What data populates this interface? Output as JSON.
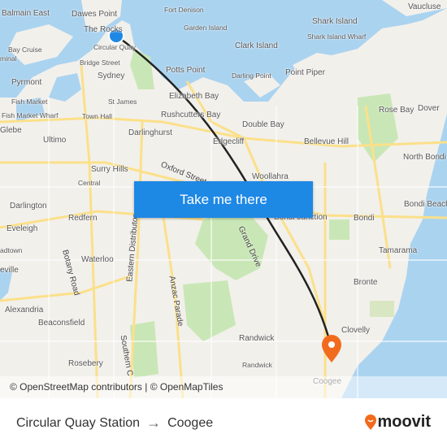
{
  "map": {
    "labels": [
      "Balmain East",
      "Dawes Point",
      "The Rocks",
      "Circular Quay",
      "Bridge Street",
      "Sydney",
      "Pyrmont",
      "Fish Market",
      "Fish Market Wharf",
      "St James",
      "Town Hall",
      "Ultimo",
      "Darlinghurst",
      "Surry Hills",
      "Central",
      "Darlington",
      "Redfern",
      "Eveleigh",
      "Waterloo",
      "Alexandria",
      "Beaconsfield",
      "Rosebery",
      "Fort Denison",
      "Garden Island",
      "Shark Island",
      "Shark Island Wharf",
      "Clark Island",
      "Potts Point",
      "Darling Point",
      "Point Piper",
      "Elizabeth Bay",
      "Rushcutters Bay",
      "Double Bay",
      "Edgecliff",
      "Bellevue Hill",
      "Rose Bay",
      "Dover",
      "North Bondi",
      "Woollahra",
      "Bondi Junction",
      "Bondi",
      "Bondi Beach",
      "Tamarama",
      "Bronte",
      "Clovelly",
      "Randwick",
      "Randwick",
      "Coogee",
      "Vaucluse",
      "Bay Cruise",
      "minal",
      "Glebe",
      "adtown",
      "eville"
    ],
    "streets": [
      "Oxford Street",
      "Botany Road",
      "Eastern Distributor",
      "Anzac Parade",
      "Grand Drive",
      "Southern C"
    ],
    "colors": {
      "water": "#aad3f0",
      "park": "#c9e7b6",
      "land": "#f2f0eb",
      "road": "#fbe08a",
      "route": "#222222",
      "origin": "#1e88e5",
      "destination": "#f26b1d"
    }
  },
  "origin": {
    "name": "Circular Quay Station",
    "icon": "origin-dot-icon"
  },
  "destination": {
    "name": "Coogee",
    "icon": "destination-pin-icon"
  },
  "cta_label": "Take me there",
  "attribution": "© OpenStreetMap contributors | © OpenMapTiles",
  "footer": {
    "from": "Circular Quay Station",
    "arrow": "→",
    "to": "Coogee",
    "brand": "moovit"
  }
}
